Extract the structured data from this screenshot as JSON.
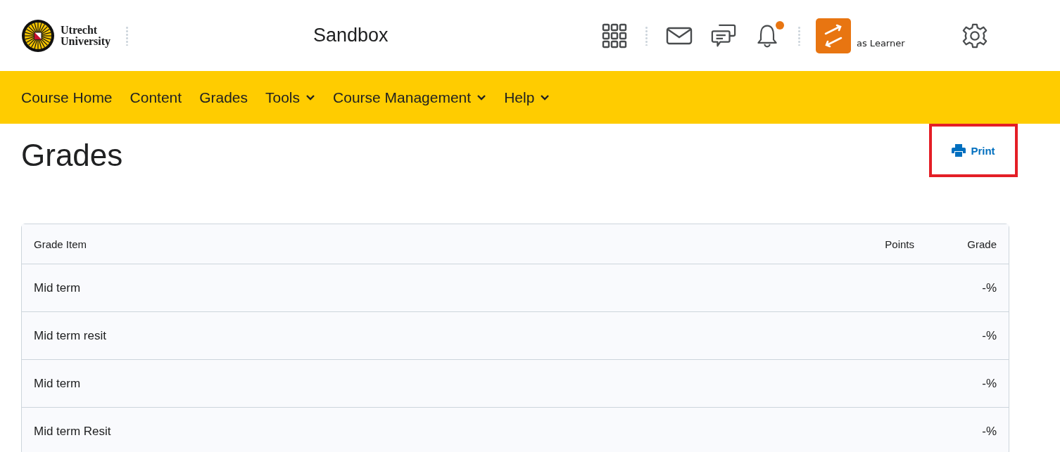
{
  "header": {
    "logo_text": [
      "Utrecht",
      "University"
    ],
    "course_title": "Sandbox",
    "notification": true,
    "role_label": "as Learner"
  },
  "nav": [
    {
      "label": "Course Home",
      "dropdown": false
    },
    {
      "label": "Content",
      "dropdown": false
    },
    {
      "label": "Grades",
      "dropdown": false
    },
    {
      "label": "Tools",
      "dropdown": true
    },
    {
      "label": "Course Management",
      "dropdown": true
    },
    {
      "label": "Help",
      "dropdown": true
    }
  ],
  "page": {
    "title": "Grades",
    "print_button": "Print",
    "highlighted": true
  },
  "table": {
    "columns": [
      "Grade Item",
      "Points",
      "Grade"
    ],
    "rows": [
      [
        "Mid term",
        "",
        "-%"
      ],
      [
        "Mid term resit",
        "",
        "-%"
      ],
      [
        "Mid term",
        "",
        "-%"
      ],
      [
        "Mid term Resit",
        "",
        "-%"
      ]
    ]
  }
}
